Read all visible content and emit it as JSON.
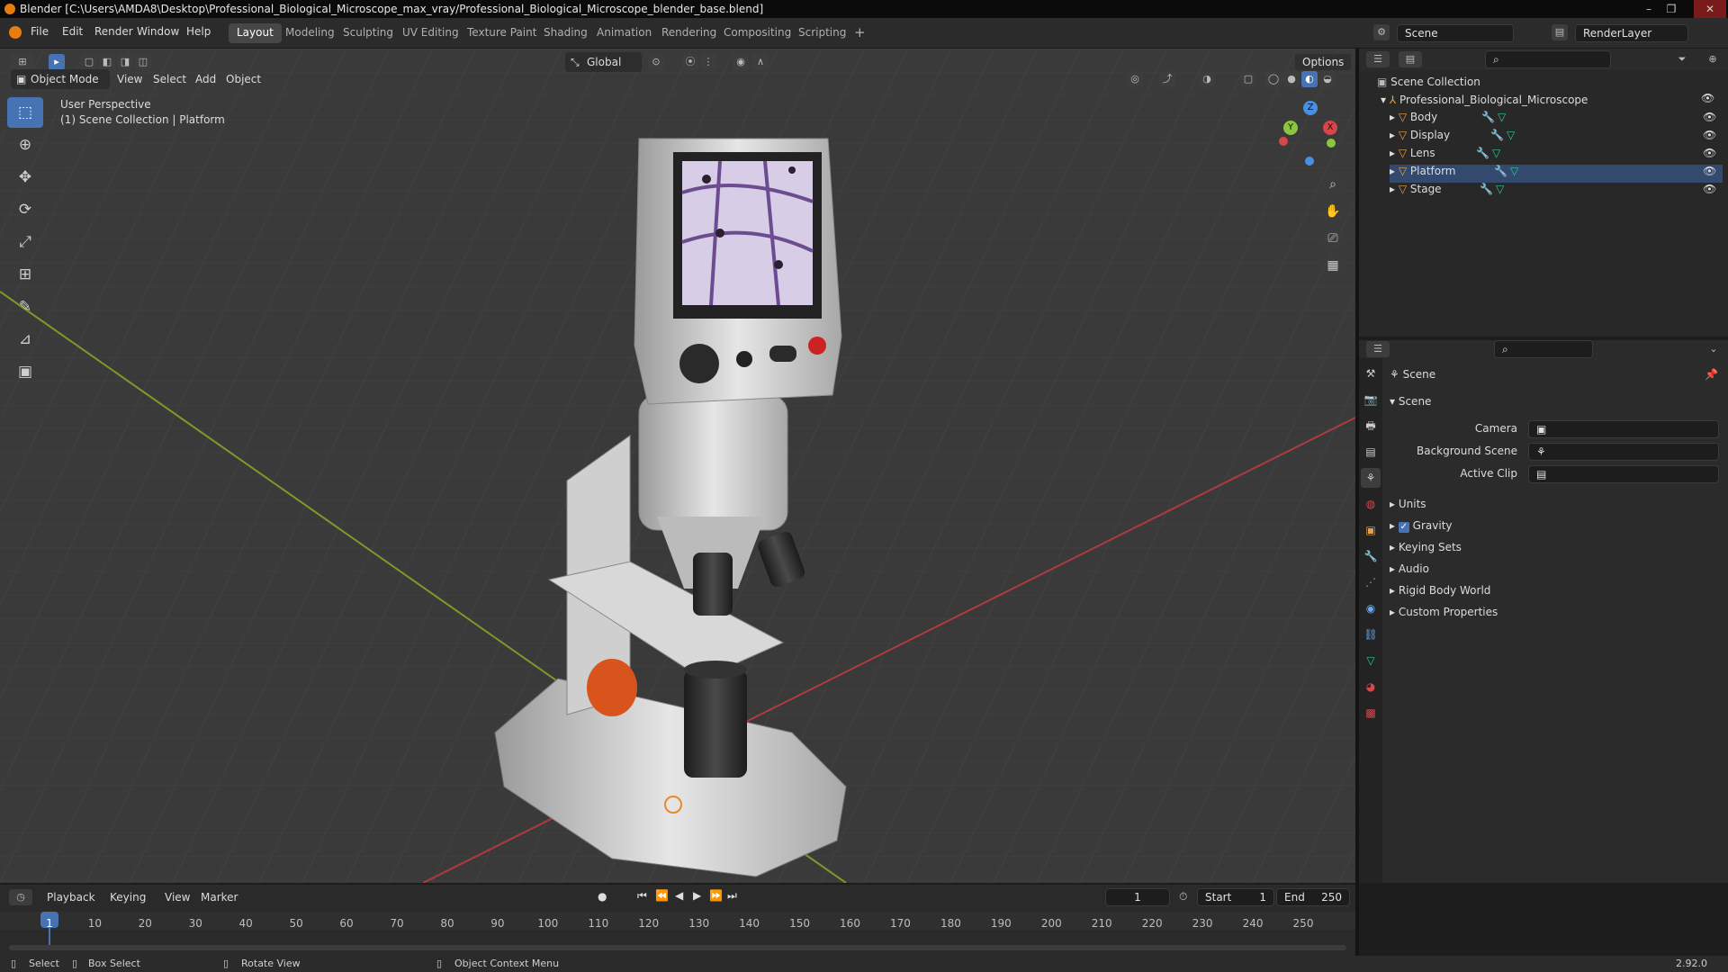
{
  "window": {
    "title": "Blender [C:\\Users\\AMDA8\\Desktop\\Professional_Biological_Microscope_max_vray/Professional_Biological_Microscope_blender_base.blend]",
    "controls": [
      "–",
      "❐",
      "✕"
    ]
  },
  "menu": [
    "File",
    "Edit",
    "Render",
    "Window",
    "Help"
  ],
  "workspaces": [
    "Layout",
    "Modeling",
    "Sculpting",
    "UV Editing",
    "Texture Paint",
    "Shading",
    "Animation",
    "Rendering",
    "Compositing",
    "Scripting"
  ],
  "active_workspace": "Layout",
  "add_workspace": "+",
  "scene_field": "Scene",
  "view_layer_field": "RenderLayer",
  "viewport": {
    "mode": "Object Mode",
    "header_menus": [
      "View",
      "Select",
      "Add",
      "Object"
    ],
    "orientation": "Global",
    "options": "Options",
    "overlay_line1": "User Perspective",
    "overlay_line2": "(1) Scene Collection | Platform",
    "gizmo_axes": {
      "x": "X",
      "y": "Y",
      "z": "Z"
    }
  },
  "tools": [
    {
      "name": "select-box",
      "glyph": "⬚"
    },
    {
      "name": "cursor",
      "glyph": "⊕"
    },
    {
      "name": "move",
      "glyph": "✥"
    },
    {
      "name": "rotate",
      "glyph": "⟳"
    },
    {
      "name": "scale",
      "glyph": "⤢"
    },
    {
      "name": "transform",
      "glyph": "⊞"
    },
    {
      "name": "annotate",
      "glyph": "✎"
    },
    {
      "name": "measure",
      "glyph": "📐"
    },
    {
      "name": "add-cube",
      "glyph": "▣"
    }
  ],
  "outliner": {
    "root": "Scene Collection",
    "collection": "Professional_Biological_Microscope",
    "objects": [
      "Body",
      "Display",
      "Lens",
      "Platform",
      "Stage"
    ],
    "selected": "Platform"
  },
  "properties": {
    "context": "Scene",
    "section": "Scene",
    "fields": [
      {
        "label": "Camera",
        "value": ""
      },
      {
        "label": "Background Scene",
        "value": ""
      },
      {
        "label": "Active Clip",
        "value": ""
      }
    ],
    "panels": [
      {
        "label": "Units",
        "checkbox": false
      },
      {
        "label": "Gravity",
        "checkbox": true
      },
      {
        "label": "Keying Sets",
        "checkbox": false
      },
      {
        "label": "Audio",
        "checkbox": false
      },
      {
        "label": "Rigid Body World",
        "checkbox": false
      },
      {
        "label": "Custom Properties",
        "checkbox": false
      }
    ]
  },
  "timeline": {
    "menus": [
      "Playback",
      "Keying",
      "View",
      "Marker"
    ],
    "current_frame": "1",
    "start_label": "Start",
    "start": "1",
    "end_label": "End",
    "end": "250",
    "ticks": [
      "1",
      "10",
      "20",
      "30",
      "40",
      "50",
      "60",
      "70",
      "80",
      "90",
      "100",
      "110",
      "120",
      "130",
      "140",
      "150",
      "160",
      "170",
      "180",
      "190",
      "200",
      "210",
      "220",
      "230",
      "240",
      "250"
    ]
  },
  "status": {
    "select": "Select",
    "box_select": "Box Select",
    "rotate_view": "Rotate View",
    "context_menu": "Object Context Menu",
    "version": "2.92.0"
  },
  "colors": {
    "accent": "#4772b3",
    "orange": "#e87d0d",
    "x_axis": "#d9464a",
    "y_axis": "#8cc63f",
    "z_axis": "#4a8fe2"
  }
}
